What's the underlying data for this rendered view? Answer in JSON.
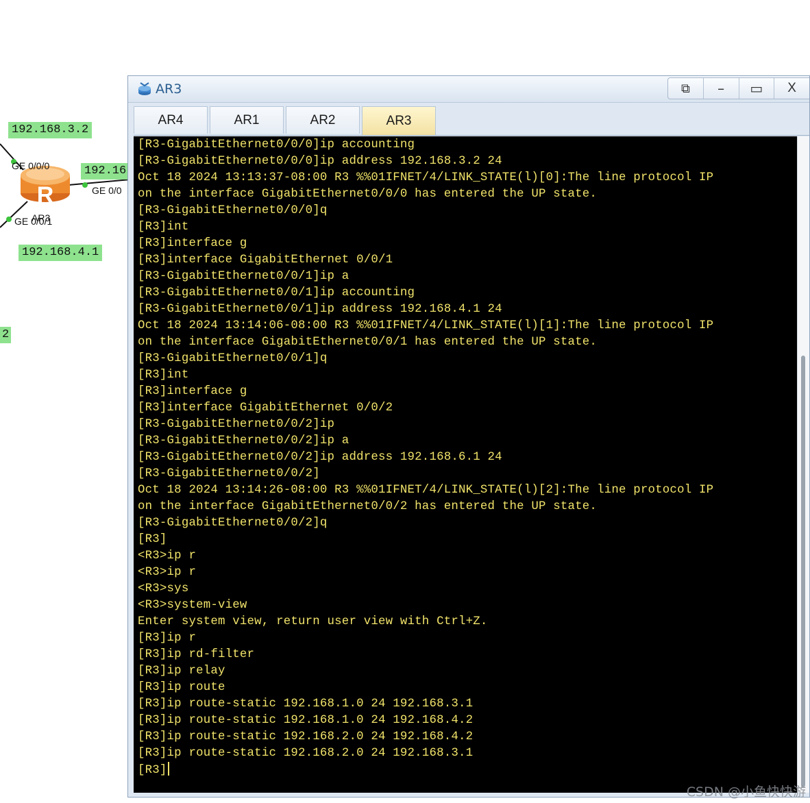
{
  "topology": {
    "router_name": "AR3",
    "router_letter": "R",
    "ip_labels": [
      "192.168.3.2",
      "192.16",
      "192.168.4.1",
      "2"
    ],
    "ports": [
      "GE 0/0/0",
      "GE 0/0",
      "GE 0/0/1"
    ]
  },
  "window": {
    "title": "AR3",
    "controls": {
      "restore": "⧉",
      "minimize": "–",
      "maximize": "▭",
      "close": "X"
    },
    "tabs": [
      {
        "label": "AR4",
        "active": false
      },
      {
        "label": "AR1",
        "active": false
      },
      {
        "label": "AR2",
        "active": false
      },
      {
        "label": "AR3",
        "active": true
      }
    ]
  },
  "terminal": {
    "lines": [
      "[R3-GigabitEthernet0/0/0]ip accounting",
      "[R3-GigabitEthernet0/0/0]ip address 192.168.3.2 24",
      "Oct 18 2024 13:13:37-08:00 R3 %%01IFNET/4/LINK_STATE(l)[0]:The line protocol IP",
      "on the interface GigabitEthernet0/0/0 has entered the UP state.",
      "[R3-GigabitEthernet0/0/0]q",
      "[R3]int",
      "[R3]interface g",
      "[R3]interface GigabitEthernet 0/0/1",
      "[R3-GigabitEthernet0/0/1]ip a",
      "[R3-GigabitEthernet0/0/1]ip accounting",
      "[R3-GigabitEthernet0/0/1]ip address 192.168.4.1 24",
      "Oct 18 2024 13:14:06-08:00 R3 %%01IFNET/4/LINK_STATE(l)[1]:The line protocol IP",
      "on the interface GigabitEthernet0/0/1 has entered the UP state.",
      "[R3-GigabitEthernet0/0/1]q",
      "[R3]int",
      "[R3]interface g",
      "[R3]interface GigabitEthernet 0/0/2",
      "[R3-GigabitEthernet0/0/2]ip",
      "[R3-GigabitEthernet0/0/2]ip a",
      "[R3-GigabitEthernet0/0/2]ip address 192.168.6.1 24",
      "[R3-GigabitEthernet0/0/2]",
      "Oct 18 2024 13:14:26-08:00 R3 %%01IFNET/4/LINK_STATE(l)[2]:The line protocol IP",
      "on the interface GigabitEthernet0/0/2 has entered the UP state.",
      "[R3-GigabitEthernet0/0/2]q",
      "[R3]",
      "<R3>ip r",
      "<R3>ip r",
      "<R3>sys",
      "<R3>system-view",
      "Enter system view, return user view with Ctrl+Z.",
      "[R3]ip r",
      "[R3]ip rd-filter",
      "[R3]ip relay",
      "[R3]ip route",
      "[R3]ip route-static 192.168.1.0 24 192.168.3.1",
      "[R3]ip route-static 192.168.1.0 24 192.168.4.2",
      "[R3]ip route-static 192.168.2.0 24 192.168.4.2",
      "[R3]ip route-static 192.168.2.0 24 192.168.3.1",
      "[R3]"
    ]
  },
  "watermark": "CSDN @小鱼快快游",
  "colors": {
    "terminal_bg": "#000000",
    "terminal_text": "#f1e36a",
    "ip_label_bg": "#8ee28e"
  }
}
